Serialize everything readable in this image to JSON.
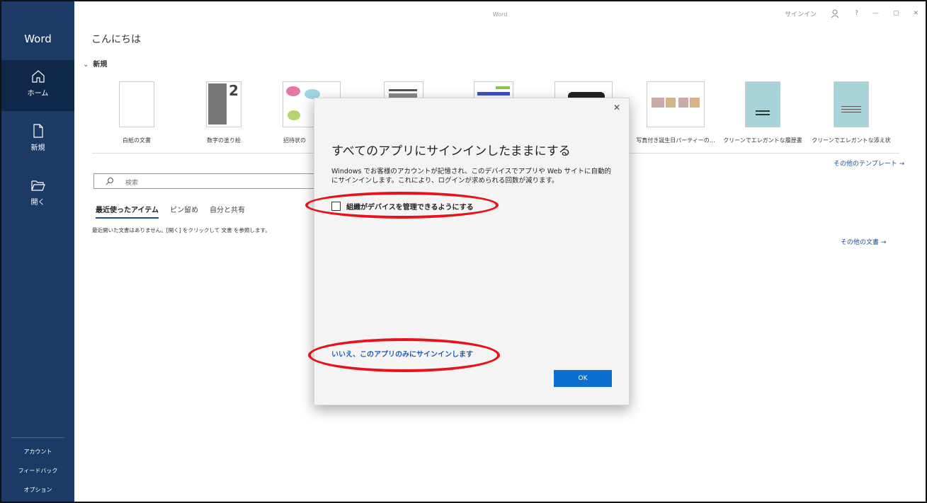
{
  "window": {
    "app_title": "Word",
    "sign_in": "サインイン",
    "help": "?",
    "minimize": "—",
    "restore": "▢",
    "close": "✕"
  },
  "sidebar": {
    "brand": "Word",
    "items": [
      {
        "label": "ホーム",
        "icon": "home-icon"
      },
      {
        "label": "新規",
        "icon": "new-document-icon"
      },
      {
        "label": "開く",
        "icon": "folder-open-icon"
      }
    ],
    "bottom": [
      "アカウント",
      "フィードバック",
      "オプション"
    ]
  },
  "main": {
    "greeting": "こんにちは",
    "new_section": "新規",
    "templates": [
      "白紙の文書",
      "数字の塗り絵",
      "招待状の",
      "",
      "",
      "",
      "写真付き誕生日パーティーの…",
      "クリーンでエレガントな履歴書",
      "クリーンでエレガントな添え状"
    ],
    "more_templates": "その他のテンプレート →",
    "search_placeholder": "検索",
    "tabs": [
      "最近使ったアイテム",
      "ピン留め",
      "自分と共有"
    ],
    "empty_message": "最近開いた文書はありません。[開く] をクリックして 文書 を参照します。",
    "more_documents": "その他の文書 →"
  },
  "dialog": {
    "title": "すべてのアプリにサインインしたままにする",
    "body": "Windows でお客様のアカウントが記憶され、このデバイスでアプリや Web サイトに自動的にサインインします。これにより、ログインが求められる回数が減ります。",
    "checkbox_label": "組織がデバイスを管理できるようにする",
    "checkbox_checked": false,
    "link": "いいえ、このアプリのみにサインインします",
    "ok_label": "OK"
  },
  "colors": {
    "sidebar": "#1b3a66",
    "accent": "#0a6fd1",
    "annotation": "#e5141b"
  }
}
